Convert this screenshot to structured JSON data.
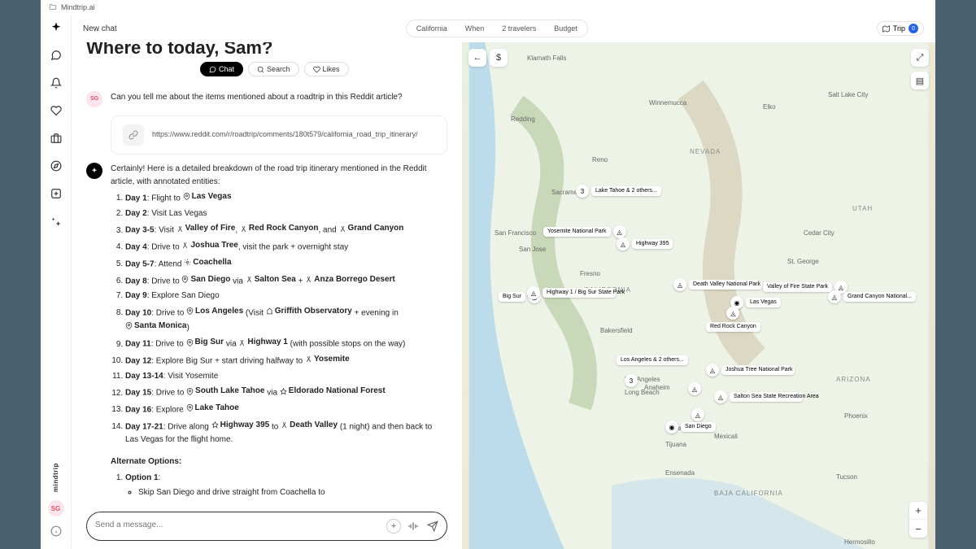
{
  "titlebar": {
    "app": "Mindtrip.ai"
  },
  "sidebar": {
    "brand": "mindtrip",
    "avatar": "SG"
  },
  "topbar": {
    "newchat": "New chat",
    "filters": [
      "California",
      "When",
      "2 travelers",
      "Budget"
    ],
    "trip": {
      "label": "Trip",
      "count": "0"
    }
  },
  "hero": "Where to today, Sam?",
  "tabs": {
    "chat": "Chat",
    "search": "Search",
    "likes": "Likes"
  },
  "user_msg": {
    "avatar": "SG",
    "text": "Can you tell me about the items mentioned about a roadtrip in this Reddit article?"
  },
  "link": {
    "url": "https://www.reddit.com/r/roadtrip/comments/180t579/california_road_trip_itinerary/"
  },
  "ai_intro": "Certainly! Here is a detailed breakdown of the road trip itinerary mentioned in the Reddit article, with annotated entities:",
  "days": {
    "d1": {
      "day": "Day 1",
      "a": ": Flight to ",
      "e1": "Las Vegas"
    },
    "d2": {
      "day": "Day 2",
      "a": ": Visit Las Vegas"
    },
    "d3": {
      "day": "Day 3-5",
      "a": ": Visit ",
      "e1": "Valley of Fire",
      "b": ", ",
      "e2": "Red Rock Canyon",
      "c": ", and ",
      "e3": "Grand Canyon"
    },
    "d4": {
      "day": "Day 4",
      "a": ": Drive to ",
      "e1": "Joshua Tree",
      "b": ", visit the park + overnight stay"
    },
    "d5": {
      "day": "Day 5-7",
      "a": ": Attend ",
      "e1": "Coachella"
    },
    "d6": {
      "day": "Day 8",
      "a": ": Drive to ",
      "e1": "San Diego",
      "b": " via ",
      "e2": "Salton Sea",
      "c": " + ",
      "e3": "Anza Borrego Desert"
    },
    "d7": {
      "day": "Day 9",
      "a": ": Explore San Diego"
    },
    "d8": {
      "day": "Day 10",
      "a": ": Drive to ",
      "e1": "Los Angeles",
      "b": " (Visit ",
      "e2": "Griffith Observatory",
      "c": " + evening in ",
      "e3": "Santa Monica",
      "d": ")"
    },
    "d9": {
      "day": "Day 11",
      "a": ": Drive to ",
      "e1": "Big Sur",
      "b": " via ",
      "e2": "Highway 1",
      "c": " (with possible stops on the way)"
    },
    "d10": {
      "day": "Day 12",
      "a": ": Explore Big Sur + start driving halfway to ",
      "e1": "Yosemite"
    },
    "d11": {
      "day": "Day 13-14",
      "a": ": Visit Yosemite"
    },
    "d12": {
      "day": "Day 15",
      "a": ": Drive to ",
      "e1": "South Lake Tahoe",
      "b": " via ",
      "e2": "Eldorado National Forest"
    },
    "d13": {
      "day": "Day 16",
      "a": ": Explore ",
      "e1": "Lake Tahoe"
    },
    "d14": {
      "day": "Day 17-21",
      "a": ": Drive along ",
      "e1": "Highway 395",
      "b": " to ",
      "e2": "Death Valley",
      "c": " (1 night) and then back to Las Vegas for the flight home."
    }
  },
  "alt_head": "Alternate Options:",
  "alt1": {
    "title": "Option 1",
    "bullet": "Skip San Diego and drive straight from Coachella to"
  },
  "input": {
    "placeholder": "Send a message..."
  },
  "map": {
    "states": {
      "nevada": "NEVADA",
      "california": "CALIFORNIA",
      "utah": "UTAH",
      "arizona": "ARIZONA",
      "baja": "BAJA CALIFORNIA"
    },
    "cities": {
      "sf": "San Francisco",
      "sj": "San Jose",
      "sac": "Sacramento",
      "la": "Los Angeles",
      "sd": "San Diego",
      "tij": "Tijuana",
      "lv": "Las Vegas",
      "phx": "Phoenix",
      "fresno": "Fresno",
      "bakersfield": "Bakersfield",
      "reno": "Reno",
      "slc": "Salt Lake City",
      "tucson": "Tucson",
      "klamath": "Klamath Falls",
      "redding": "Redding",
      "winnemucca": "Winnemucca",
      "elko": "Elko",
      "cedar": "Cedar City",
      "stg": "St. George",
      "anaheim": "Anaheim",
      "lbeach": "Long Beach",
      "ensenada": "Ensenada",
      "mexicali": "Mexicali",
      "hermosillo": "Hermosillo"
    },
    "pois": {
      "tahoe": "Lake Tahoe & 2 others...",
      "yosemite": "Yosemite National Park",
      "hwy395": "Highway 395",
      "bigsur": "Big Sur",
      "hwy1": "Highway 1 / Big Sur State Park",
      "dv": "Death Valley National Park",
      "vof": "Valley of Fire State Park",
      "lvp": "Las Vegas",
      "rrc": "Red Rock Canyon",
      "gc": "Grand Canyon National...",
      "la2": "Los Angeles & 2 others...",
      "jt": "Joshua Tree National Park",
      "salton": "Salton Sea State Recreation Area",
      "sdp": "San Diego"
    },
    "counts": {
      "tahoe": "3",
      "la": "3"
    }
  }
}
